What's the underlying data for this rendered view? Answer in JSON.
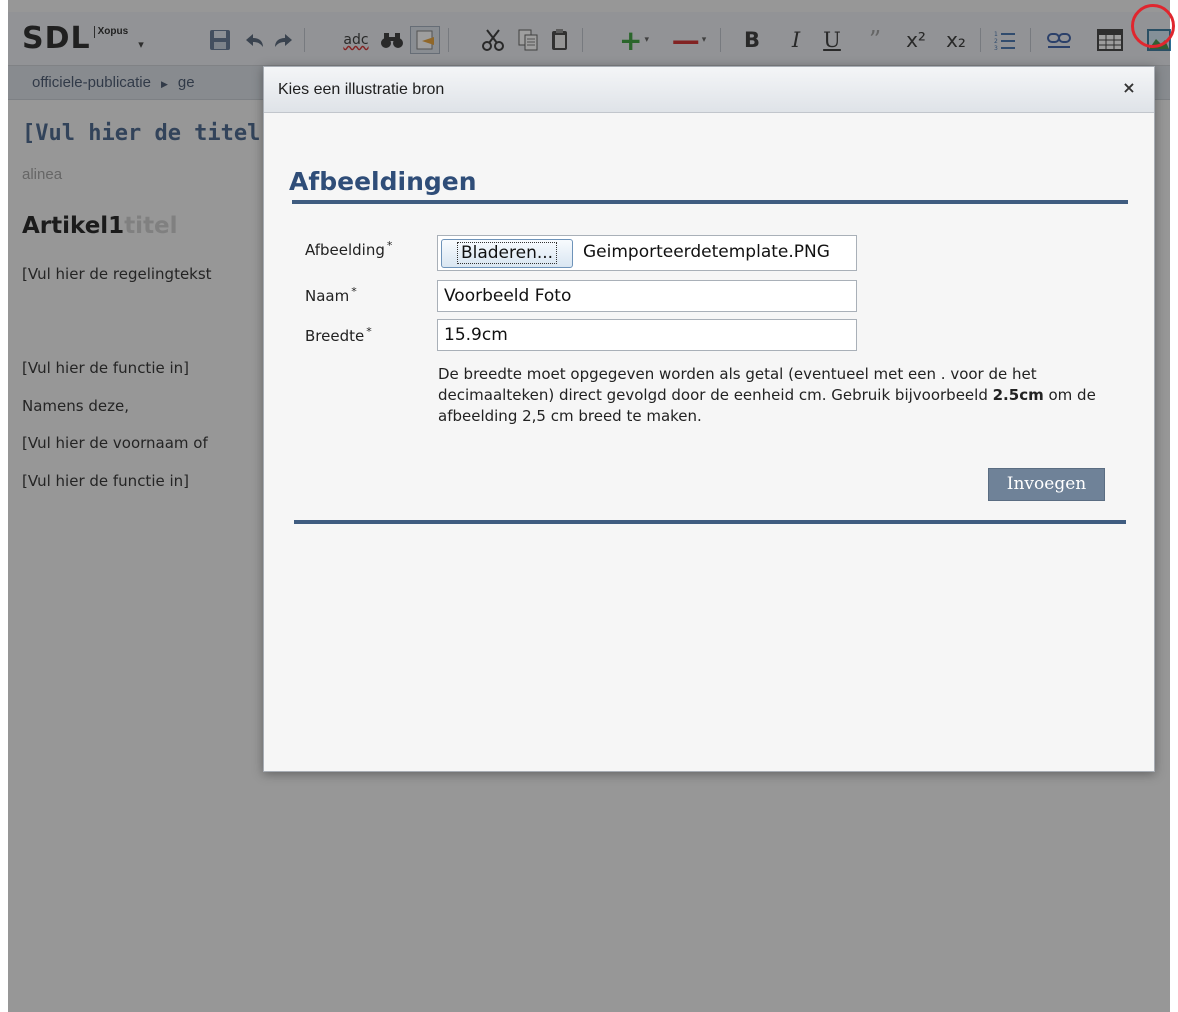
{
  "app": {
    "logo_main": "SDL",
    "logo_sub": "Xopus"
  },
  "toolbar": {
    "save_icon": "save-icon",
    "undo_icon": "undo-icon",
    "redo_icon": "redo-icon",
    "spellcheck_label": "adc",
    "find_icon": "binoculars-icon",
    "track_changes_icon": "track-changes-icon",
    "cut_icon": "scissors-icon",
    "copy_icon": "copy-icon",
    "paste_icon": "paste-icon",
    "add_icon": "plus-icon",
    "remove_icon": "minus-icon",
    "bold_label": "B",
    "italic_label": "I",
    "underline_label": "U",
    "quote_label": "”",
    "superscript_label": "x²",
    "subscript_label": "x₂",
    "list_icon": "numbered-list-icon",
    "link_icon": "link-icon",
    "table_icon": "table-icon",
    "image_icon": "image-icon",
    "highlight_color": "#e0262e"
  },
  "breadcrumb": {
    "items": [
      "officiele-publicatie",
      "ge"
    ]
  },
  "document": {
    "title_placeholder": "[Vul hier de titel in",
    "alinea_label": "alinea",
    "article_prefix": "Artikel1",
    "article_suffix": "titel",
    "paragraphs": [
      "[Vul hier de regelingtekst",
      "[Vul hier de functie in]",
      "Namens deze,",
      "[Vul hier de voornaam of",
      "[Vul hier de functie in]"
    ]
  },
  "dialog": {
    "title": "Kies een illustratie bron",
    "close_label": "×",
    "section_heading": "Afbeeldingen",
    "fields": {
      "image_label": "Afbeelding",
      "name_label": "Naam",
      "width_label": "Breedte",
      "required_marker": "*"
    },
    "browse_label": "Bladeren...",
    "file_name": "Geimporteerdetemplate.PNG",
    "name_value": "Voorbeeld Foto",
    "width_value": "15.9cm",
    "hint_before": "De breedte moet opgegeven worden als getal (eventueel met een . voor de het decimaalteken) direct gevolgd door de eenheid cm. Gebruik bijvoorbeeld ",
    "hint_example": "2.5cm",
    "hint_after": " om de afbeelding 2,5 cm breed te maken.",
    "insert_label": "Invoegen",
    "accent_color": "#2f4d78"
  }
}
